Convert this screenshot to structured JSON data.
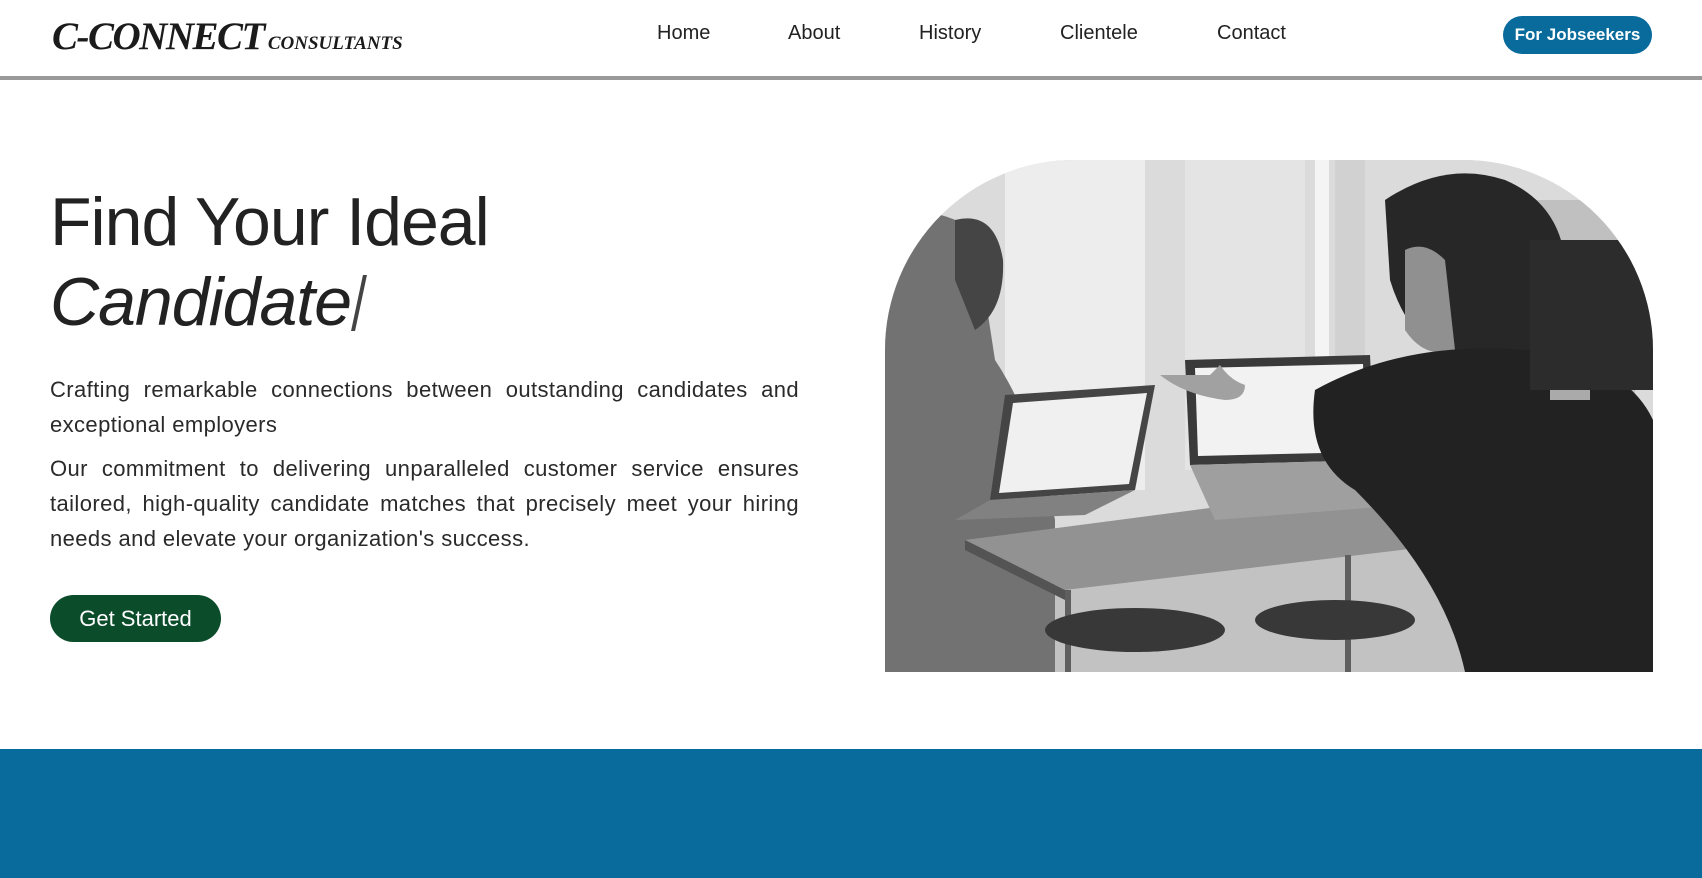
{
  "logo": {
    "main": "C-CONNECT",
    "sub": "CONSULTANTS"
  },
  "nav": {
    "items": [
      {
        "label": "Home"
      },
      {
        "label": "About"
      },
      {
        "label": "History"
      },
      {
        "label": "Clientele"
      },
      {
        "label": "Contact"
      }
    ],
    "cta_label": "For Jobseekers"
  },
  "hero": {
    "title_line1": "Find Your Ideal",
    "title_line2": "Candidate",
    "paragraph1": "Crafting remarkable connections between outstanding candidates and exceptional employers",
    "paragraph2": "Our commitment to delivering unparalleled customer service ensures tailored, high-quality candidate matches that precisely meet your hiring needs and elevate your organization's success.",
    "cta_label": "Get Started"
  },
  "colors": {
    "brand_blue": "#086b9c",
    "cta_green": "#0b4d2a",
    "header_border": "#9a9a9a"
  },
  "icons": {
    "photo": "office-meeting-photo"
  }
}
